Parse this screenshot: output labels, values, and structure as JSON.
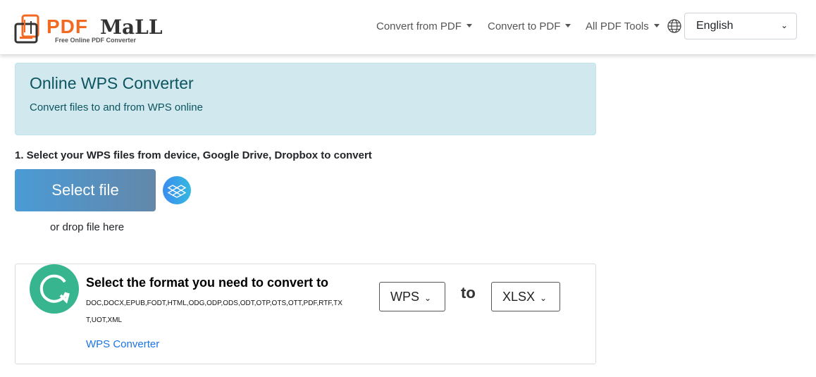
{
  "header": {
    "logo_text_pdf": "PDF",
    "logo_text_mall": "MaLL",
    "logo_tagline": "Free Online PDF Converter",
    "nav": [
      {
        "label": "Convert from PDF"
      },
      {
        "label": "Convert to PDF"
      },
      {
        "label": "All PDF Tools"
      }
    ],
    "language": "English"
  },
  "alert": {
    "title": "Online WPS Converter",
    "subtitle": "Convert files to and from WPS online"
  },
  "upload": {
    "step_label": "1. Select your WPS files from device, Google Drive, Dropbox to convert",
    "select_button": "Select file",
    "drop_text": "or drop file here"
  },
  "format": {
    "title": "Select the format you need to convert to",
    "formats": "DOC,DOCX,EPUB,FODT,HTML,ODG,ODP,ODS,ODT,OTP,OTS,OTT,PDF,RTF,TXT,UOT,XML",
    "link": "WPS Converter",
    "from": "WPS",
    "to_label": "to",
    "to": "XLSX"
  },
  "colors": {
    "accent_green": "#36b58f",
    "link": "#1a73e8",
    "alert_bg": "#d1e9ee",
    "logo_orange": "#f26a22"
  }
}
